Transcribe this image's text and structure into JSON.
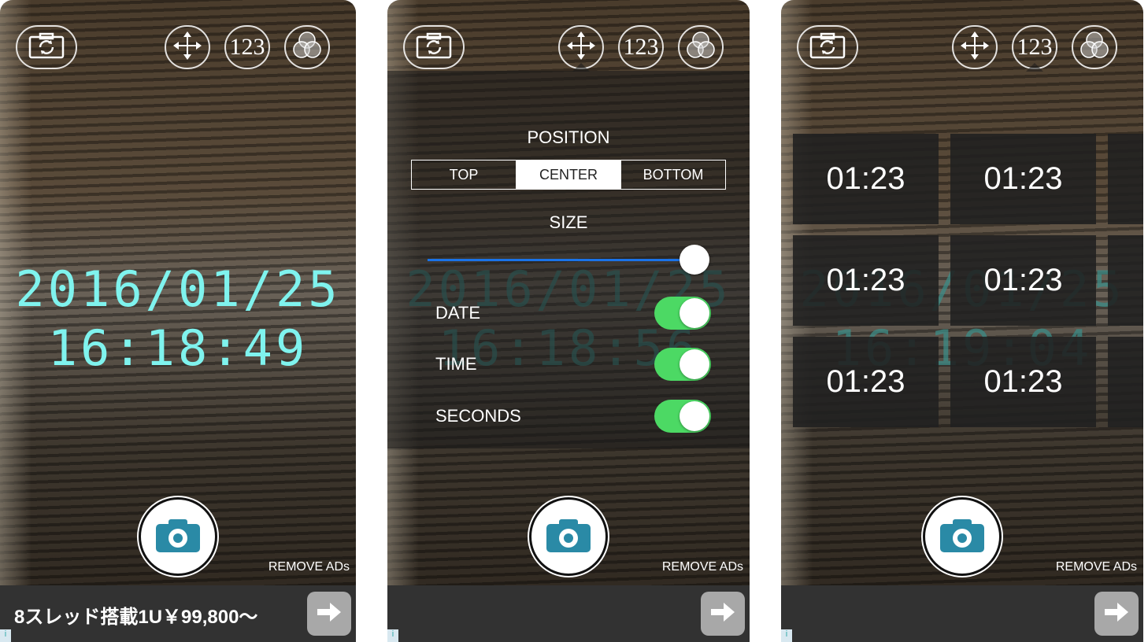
{
  "colors": {
    "clock": "#7ff3ee",
    "toggle_on": "#4cd964",
    "slider": "#1a73e8",
    "shutter_icon": "#2a8aa6",
    "ad_bar": "#323232"
  },
  "topbar": {
    "flip_icon": "camera-switch-icon",
    "move_icon": "move-arrows-icon",
    "number_label": "123",
    "filter_icon": "color-filter-icon"
  },
  "screen1": {
    "date": "2016/01/25",
    "time": "16:18:49",
    "remove_ads": "REMOVE ADs",
    "ad_text": "8スレッド搭載1U￥99,800〜"
  },
  "screen2": {
    "date": "2016/01/25",
    "time": "16:18:56",
    "remove_ads": "REMOVE ADs",
    "position_label": "POSITION",
    "position_options": [
      "TOP",
      "CENTER",
      "BOTTOM"
    ],
    "position_selected": "CENTER",
    "size_label": "SIZE",
    "size_value_percent": 100,
    "toggles": [
      {
        "label": "DATE",
        "on": true
      },
      {
        "label": "TIME",
        "on": true
      },
      {
        "label": "SECONDS",
        "on": true
      }
    ]
  },
  "screen3": {
    "date": "2016/01/25",
    "time": "16:19:04",
    "remove_ads": "REMOVE ADs",
    "font_samples": [
      "01:23",
      "01:23",
      "01:23",
      "01:23",
      "01:23",
      "01:23"
    ]
  }
}
